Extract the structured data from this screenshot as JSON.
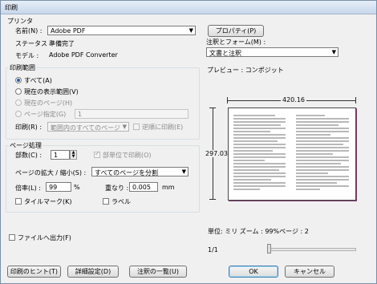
{
  "window": {
    "title": "印刷"
  },
  "printer": {
    "group_label": "プリンタ",
    "name_label": "名前(N) :",
    "name_value": "Adobe PDF",
    "properties_button": "プロパティ(P)",
    "status_label": "ステータス :",
    "status_value": "準備完了",
    "model_label": "モデル :",
    "model_value": "Adobe PDF Converter"
  },
  "comments_forms": {
    "label": "注釈とフォーム(M) :",
    "value": "文書と注釈"
  },
  "print_range": {
    "group_label": "印刷範囲",
    "all": "すべて(A)",
    "current_view": "現在の表示範囲(V)",
    "current_page": "現在のページ(H)",
    "pages": "ページ指定(G)",
    "pages_value": "1",
    "subset_label": "印刷(R) :",
    "subset_value": "範囲内のすべてのページ",
    "reverse": "逆順に印刷(E)"
  },
  "page_handling": {
    "group_label": "ページ処理",
    "copies_label": "部数(C) :",
    "copies_value": "1",
    "collate": "部単位で印刷(O)",
    "scaling_label": "ページの拡大 / 縮小(S) :",
    "scaling_value": "すべてのページを分割",
    "zoom_label": "倍率(L) :",
    "zoom_value": "99",
    "zoom_unit": "%",
    "overlap_label": "重なり :",
    "overlap_value": "0.005",
    "overlap_unit": "mm",
    "tile_marks": "タイルマーク(K)",
    "labels": "ラベル"
  },
  "print_to_file": "ファイルへ出力(F)",
  "preview": {
    "label": "プレビュー : コンポジット",
    "width_measure": "420.16",
    "height_measure": "297.03",
    "status": "単位: ミリ  ズーム : 99%ページ : 2",
    "page_counter": "1/1",
    "slider_position": 0
  },
  "buttons": {
    "printing_tips": "印刷のヒント(T)",
    "advanced": "詳細設定(D)",
    "summarize_comments": "注釈の一覧(U)",
    "ok": "OK",
    "cancel": "キャンセル"
  },
  "colors": {
    "accent": "#1e5bb3",
    "page_border": "#4a4a4a",
    "page_shadow": "#7b3e6e"
  }
}
